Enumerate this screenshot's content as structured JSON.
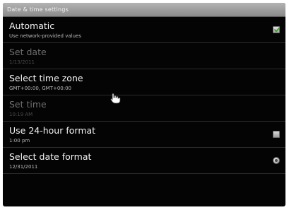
{
  "title": "Date & time settings",
  "settings": [
    {
      "label": "Automatic",
      "summary": "Use network-provided values"
    },
    {
      "label": "Set date",
      "summary": "1/13/2011"
    },
    {
      "label": "Select time zone",
      "summary": "GMT+00:00, GMT+00:00"
    },
    {
      "label": "Set time",
      "summary": "10:19 AM"
    },
    {
      "label": "Use 24-hour format",
      "summary": "1:00 pm"
    },
    {
      "label": "Select date format",
      "summary": "12/31/2011"
    }
  ],
  "states": {
    "automatic_checked": true,
    "use_24_hour_checked": false
  },
  "icons": {
    "automatic_control": "checkbox-checked-icon",
    "use_24_hour_control": "checkbox-unchecked-icon",
    "date_format_control": "radio-icon",
    "pointer": "hand-cursor-icon"
  },
  "colors": {
    "background": "#050404",
    "title_bar": "#9a9a9a",
    "check_mark": "#3e9a2f"
  }
}
